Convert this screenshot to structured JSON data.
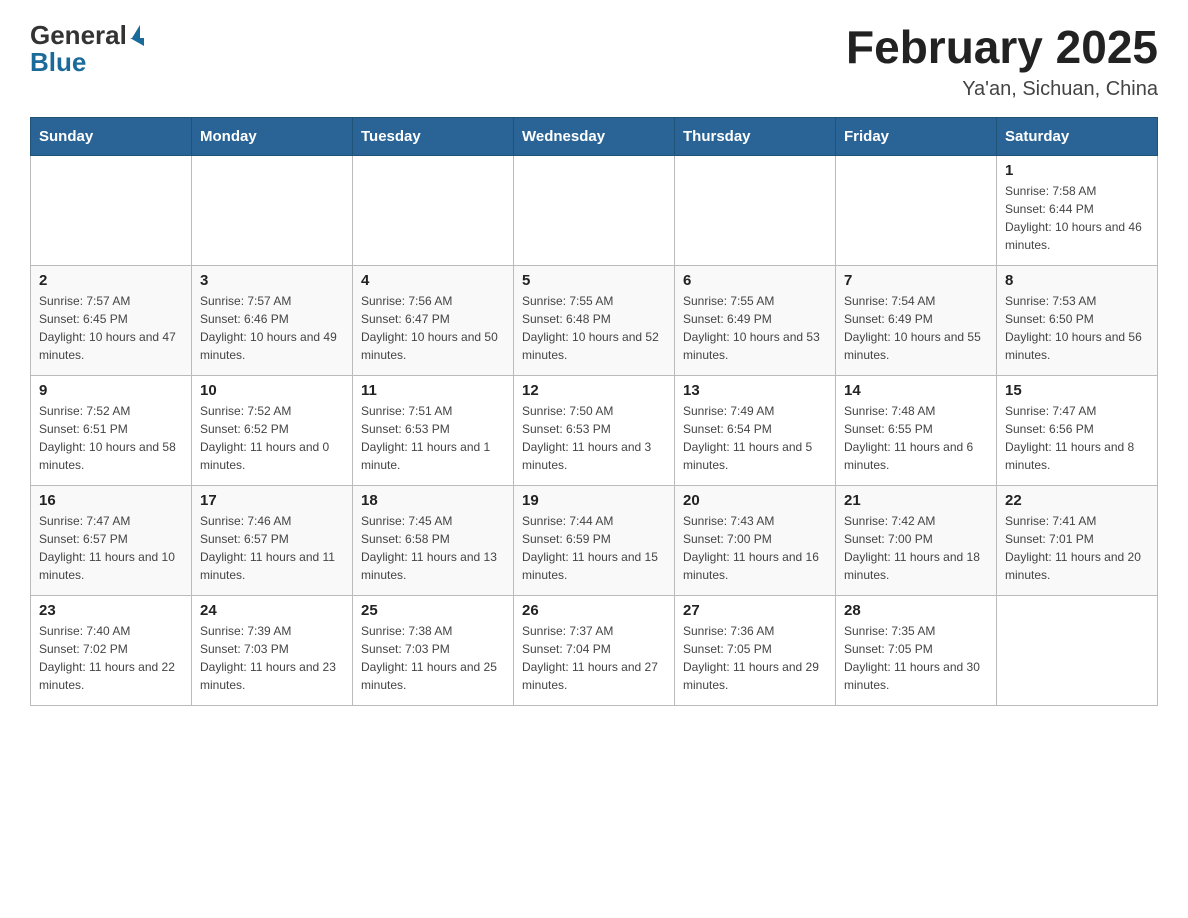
{
  "logo": {
    "general": "General",
    "blue": "Blue"
  },
  "title": "February 2025",
  "subtitle": "Ya'an, Sichuan, China",
  "days_of_week": [
    "Sunday",
    "Monday",
    "Tuesday",
    "Wednesday",
    "Thursday",
    "Friday",
    "Saturday"
  ],
  "weeks": [
    [
      {
        "day": "",
        "info": ""
      },
      {
        "day": "",
        "info": ""
      },
      {
        "day": "",
        "info": ""
      },
      {
        "day": "",
        "info": ""
      },
      {
        "day": "",
        "info": ""
      },
      {
        "day": "",
        "info": ""
      },
      {
        "day": "1",
        "info": "Sunrise: 7:58 AM\nSunset: 6:44 PM\nDaylight: 10 hours and 46 minutes."
      }
    ],
    [
      {
        "day": "2",
        "info": "Sunrise: 7:57 AM\nSunset: 6:45 PM\nDaylight: 10 hours and 47 minutes."
      },
      {
        "day": "3",
        "info": "Sunrise: 7:57 AM\nSunset: 6:46 PM\nDaylight: 10 hours and 49 minutes."
      },
      {
        "day": "4",
        "info": "Sunrise: 7:56 AM\nSunset: 6:47 PM\nDaylight: 10 hours and 50 minutes."
      },
      {
        "day": "5",
        "info": "Sunrise: 7:55 AM\nSunset: 6:48 PM\nDaylight: 10 hours and 52 minutes."
      },
      {
        "day": "6",
        "info": "Sunrise: 7:55 AM\nSunset: 6:49 PM\nDaylight: 10 hours and 53 minutes."
      },
      {
        "day": "7",
        "info": "Sunrise: 7:54 AM\nSunset: 6:49 PM\nDaylight: 10 hours and 55 minutes."
      },
      {
        "day": "8",
        "info": "Sunrise: 7:53 AM\nSunset: 6:50 PM\nDaylight: 10 hours and 56 minutes."
      }
    ],
    [
      {
        "day": "9",
        "info": "Sunrise: 7:52 AM\nSunset: 6:51 PM\nDaylight: 10 hours and 58 minutes."
      },
      {
        "day": "10",
        "info": "Sunrise: 7:52 AM\nSunset: 6:52 PM\nDaylight: 11 hours and 0 minutes."
      },
      {
        "day": "11",
        "info": "Sunrise: 7:51 AM\nSunset: 6:53 PM\nDaylight: 11 hours and 1 minute."
      },
      {
        "day": "12",
        "info": "Sunrise: 7:50 AM\nSunset: 6:53 PM\nDaylight: 11 hours and 3 minutes."
      },
      {
        "day": "13",
        "info": "Sunrise: 7:49 AM\nSunset: 6:54 PM\nDaylight: 11 hours and 5 minutes."
      },
      {
        "day": "14",
        "info": "Sunrise: 7:48 AM\nSunset: 6:55 PM\nDaylight: 11 hours and 6 minutes."
      },
      {
        "day": "15",
        "info": "Sunrise: 7:47 AM\nSunset: 6:56 PM\nDaylight: 11 hours and 8 minutes."
      }
    ],
    [
      {
        "day": "16",
        "info": "Sunrise: 7:47 AM\nSunset: 6:57 PM\nDaylight: 11 hours and 10 minutes."
      },
      {
        "day": "17",
        "info": "Sunrise: 7:46 AM\nSunset: 6:57 PM\nDaylight: 11 hours and 11 minutes."
      },
      {
        "day": "18",
        "info": "Sunrise: 7:45 AM\nSunset: 6:58 PM\nDaylight: 11 hours and 13 minutes."
      },
      {
        "day": "19",
        "info": "Sunrise: 7:44 AM\nSunset: 6:59 PM\nDaylight: 11 hours and 15 minutes."
      },
      {
        "day": "20",
        "info": "Sunrise: 7:43 AM\nSunset: 7:00 PM\nDaylight: 11 hours and 16 minutes."
      },
      {
        "day": "21",
        "info": "Sunrise: 7:42 AM\nSunset: 7:00 PM\nDaylight: 11 hours and 18 minutes."
      },
      {
        "day": "22",
        "info": "Sunrise: 7:41 AM\nSunset: 7:01 PM\nDaylight: 11 hours and 20 minutes."
      }
    ],
    [
      {
        "day": "23",
        "info": "Sunrise: 7:40 AM\nSunset: 7:02 PM\nDaylight: 11 hours and 22 minutes."
      },
      {
        "day": "24",
        "info": "Sunrise: 7:39 AM\nSunset: 7:03 PM\nDaylight: 11 hours and 23 minutes."
      },
      {
        "day": "25",
        "info": "Sunrise: 7:38 AM\nSunset: 7:03 PM\nDaylight: 11 hours and 25 minutes."
      },
      {
        "day": "26",
        "info": "Sunrise: 7:37 AM\nSunset: 7:04 PM\nDaylight: 11 hours and 27 minutes."
      },
      {
        "day": "27",
        "info": "Sunrise: 7:36 AM\nSunset: 7:05 PM\nDaylight: 11 hours and 29 minutes."
      },
      {
        "day": "28",
        "info": "Sunrise: 7:35 AM\nSunset: 7:05 PM\nDaylight: 11 hours and 30 minutes."
      },
      {
        "day": "",
        "info": ""
      }
    ]
  ]
}
